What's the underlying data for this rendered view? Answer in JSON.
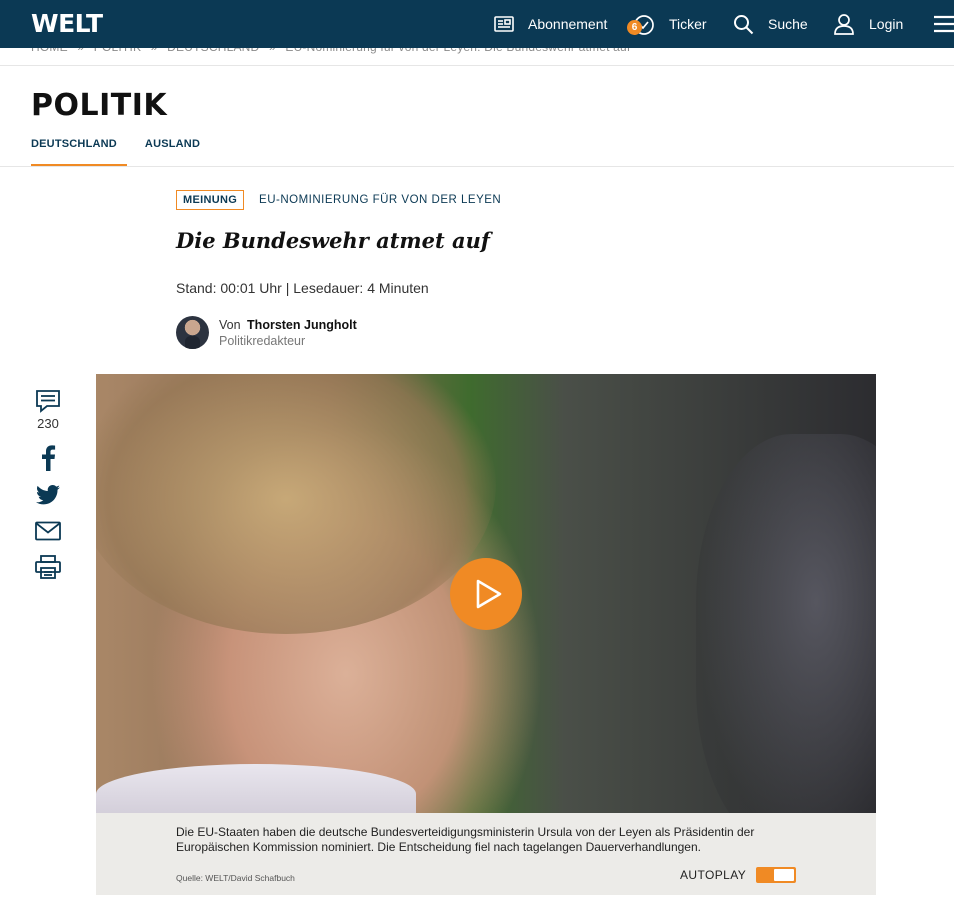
{
  "header": {
    "logo": "WELT",
    "nav": {
      "subscription": "Abonnement",
      "ticker": "Ticker",
      "ticker_badge": "6",
      "search": "Suche",
      "login": "Login"
    }
  },
  "breadcrumb": [
    "HOME",
    "»",
    "POLITIK",
    "»",
    "DEUTSCHLAND",
    "»",
    "EU-Nominierung für von der Leyen: Die Bundeswehr atmet auf"
  ],
  "section": {
    "title": "POLITIK",
    "tabs": [
      {
        "label": "DEUTSCHLAND",
        "active": true
      },
      {
        "label": "AUSLAND",
        "active": false
      }
    ]
  },
  "article": {
    "tag": "MEINUNG",
    "topic": "EU-NOMINIERUNG FÜR VON DER LEYEN",
    "headline": "Die Bundeswehr atmet auf",
    "meta": "Stand: 00:01 Uhr | Lesedauer: 4 Minuten",
    "author_prefix": "Von",
    "author_name": "Thorsten Jungholt",
    "author_role": "Politikredakteur"
  },
  "share": {
    "comment_count": "230",
    "icons": [
      "comment-icon",
      "facebook-icon",
      "twitter-icon",
      "mail-icon",
      "print-icon"
    ]
  },
  "video": {
    "caption": "Die EU-Staaten haben die deutsche Bundesverteidigungsministerin Ursula von der Leyen als Präsidentin der Europäischen Kommission nominiert. Die Entscheidung fiel nach tagelangen Dauerverhandlungen.",
    "source": "Quelle: WELT/David Schafbuch",
    "autoplay_label": "AUTOPLAY",
    "autoplay_on": true
  },
  "colors": {
    "brand": "#0b3954",
    "accent": "#f08a24",
    "caption_bg": "#ecebe8"
  }
}
